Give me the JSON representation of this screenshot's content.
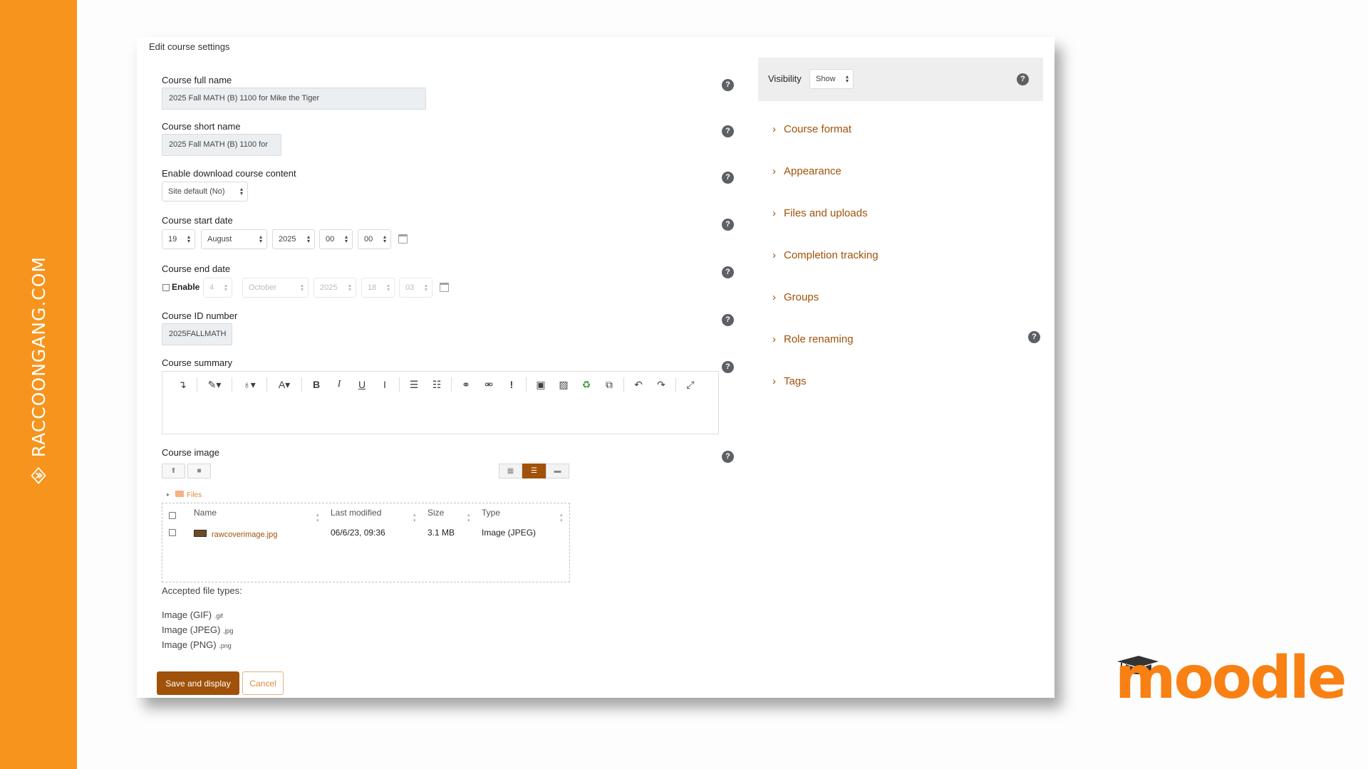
{
  "brand": {
    "site": "RACCOONGANG.COM",
    "moodle": "moodle"
  },
  "page": {
    "breadcrumb": "Edit course settings"
  },
  "form": {
    "full_name": {
      "label": "Course full name",
      "value": "2025 Fall MATH (B) 1100 for Mike the Tiger"
    },
    "short_name": {
      "label": "Course short name",
      "value": "2025 Fall MATH (B) 1100 for"
    },
    "download": {
      "label": "Enable download course content",
      "value": "Site default (No)"
    },
    "start_date": {
      "label": "Course start date",
      "day": "19",
      "month": "August",
      "year": "2025",
      "hour": "00",
      "minute": "00"
    },
    "end_date": {
      "label": "Course end date",
      "enable_label": "Enable",
      "day": "4",
      "month": "October",
      "year": "2025",
      "hour": "18",
      "minute": "03"
    },
    "id_number": {
      "label": "Course ID number",
      "value": "2025FALLMATH"
    },
    "summary": {
      "label": "Course summary"
    },
    "image": {
      "label": "Course image",
      "files_crumb": "Files",
      "columns": [
        "Name",
        "Last modified",
        "Size",
        "Type"
      ],
      "rows": [
        {
          "name": "rawcoverimage.jpg",
          "modified": "06/6/23, 09:36",
          "size": "3.1 MB",
          "type": "Image (JPEG)"
        }
      ]
    },
    "accepted": {
      "title": "Accepted file types:",
      "types": [
        {
          "name": "Image (GIF)",
          "ext": ".gif"
        },
        {
          "name": "Image (JPEG)",
          "ext": ".jpg"
        },
        {
          "name": "Image (PNG)",
          "ext": ".png"
        }
      ]
    },
    "save_label": "Save and display",
    "cancel_label": "Cancel"
  },
  "sidebar": {
    "visibility_label": "Visibility",
    "visibility_value": "Show",
    "sections": [
      "Course format",
      "Appearance",
      "Files and uploads",
      "Completion tracking",
      "Groups",
      "Role renaming",
      "Tags"
    ]
  },
  "toolbar_icons": [
    "collapse-icon",
    "paint-brush-icon",
    "lightbulb-icon",
    "font-color-icon",
    "bold-icon",
    "italic-icon",
    "underline-icon",
    "clear-format-icon",
    "bullet-list-icon",
    "numbered-list-icon",
    "link-icon",
    "unlink-icon",
    "warning-icon",
    "media-icon",
    "image-icon",
    "recycle-icon",
    "copy-icon",
    "undo-icon",
    "redo-icon",
    "fullscreen-icon"
  ],
  "colors": {
    "accent": "#a0520a",
    "brand_orange": "#f7941d",
    "moodle_orange": "#f98012"
  }
}
